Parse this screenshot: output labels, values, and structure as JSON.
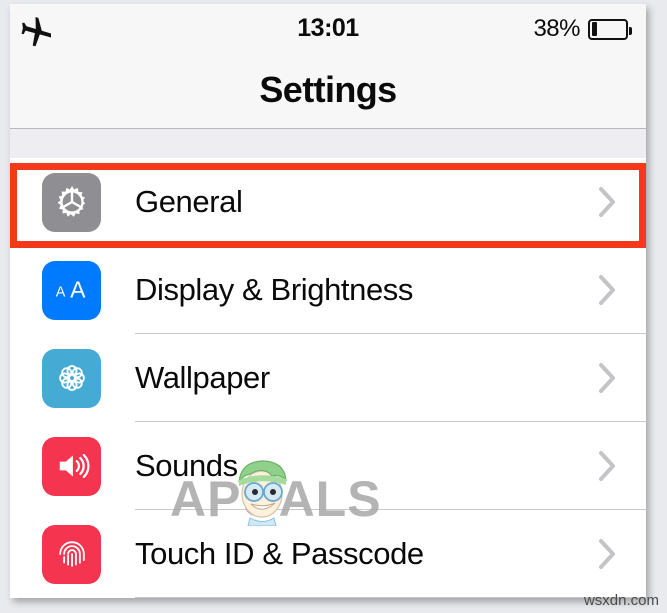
{
  "status_bar": {
    "airplane_icon": "airplane-mode-icon",
    "time": "13:01",
    "battery_percent": "38%",
    "battery_level": 38
  },
  "nav": {
    "title": "Settings"
  },
  "list": {
    "rows": [
      {
        "label": "General",
        "icon": "gear-icon",
        "icon_bg": "#8e8e93",
        "chevron": "chevron-right-icon",
        "highlighted": true
      },
      {
        "label": "Display & Brightness",
        "icon": "text-size-aa-icon",
        "icon_bg": "#007aff",
        "chevron": "chevron-right-icon",
        "highlighted": false
      },
      {
        "label": "Wallpaper",
        "icon": "flower-rosette-icon",
        "icon_bg": "#45aad4",
        "chevron": "chevron-right-icon",
        "highlighted": false
      },
      {
        "label": "Sounds",
        "icon": "speaker-volume-icon",
        "icon_bg": "#f5344f",
        "chevron": "chevron-right-icon",
        "highlighted": false
      },
      {
        "label": "Touch ID & Passcode",
        "icon": "fingerprint-icon",
        "icon_bg": "#f5344f",
        "chevron": "chevron-right-icon",
        "highlighted": false
      }
    ]
  },
  "annotation": {
    "highlight_color": "#f4381a",
    "target_row": "General"
  },
  "watermarks": {
    "brand": "PUALS",
    "brand_initial": "A",
    "brand_full": "APPUALS",
    "site": "wsxdn.com"
  }
}
